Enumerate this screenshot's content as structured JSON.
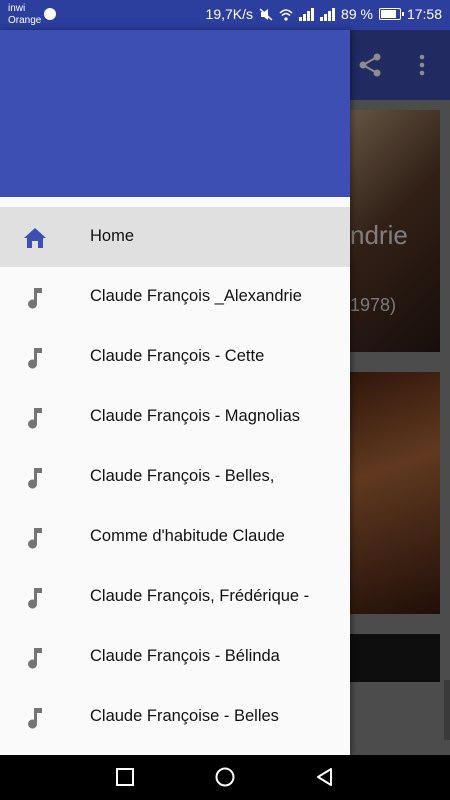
{
  "status_bar": {
    "carrier_line1": "inwi",
    "carrier_line2": "Orange",
    "net_speed": "19,7K/s",
    "battery_text": "89 %",
    "battery_level": 0.89,
    "time": "17:58",
    "icons": [
      "messenger-icon",
      "mute-icon",
      "wifi-icon",
      "signal-icon",
      "signal-icon",
      "battery-icon"
    ]
  },
  "background_app": {
    "toolbar_icons": [
      "share-icon",
      "more-vert-icon"
    ],
    "card1_title_fragment": "ndrie",
    "card1_year_fragment": "1978)"
  },
  "drawer": {
    "header_color": "#3d4fb3",
    "items": [
      {
        "label": "Home",
        "icon": "home-icon",
        "active": true
      },
      {
        "label": "Claude François _Alexandrie",
        "icon": "music-note-icon",
        "active": false
      },
      {
        "label": "Claude François - Cette",
        "icon": "music-note-icon",
        "active": false
      },
      {
        "label": "Claude François - Magnolias",
        "icon": "music-note-icon",
        "active": false
      },
      {
        "label": "Claude François - Belles,",
        "icon": "music-note-icon",
        "active": false
      },
      {
        "label": "Comme d'habitude Claude",
        "icon": "music-note-icon",
        "active": false
      },
      {
        "label": "Claude François, Frédérique -",
        "icon": "music-note-icon",
        "active": false
      },
      {
        "label": "Claude François - Bélinda",
        "icon": "music-note-icon",
        "active": false
      },
      {
        "label": "Claude Françoise - Belles",
        "icon": "music-note-icon",
        "active": false
      }
    ]
  },
  "nav_bar": {
    "icons": [
      "recents-square-icon",
      "home-circle-icon",
      "back-triangle-icon"
    ]
  },
  "colors": {
    "primary": "#3d4fb3",
    "status_bar": "#2c3e9e",
    "active_item_bg": "#e0e0e0",
    "home_icon": "#3d4fb3",
    "note_icon": "#757575"
  }
}
